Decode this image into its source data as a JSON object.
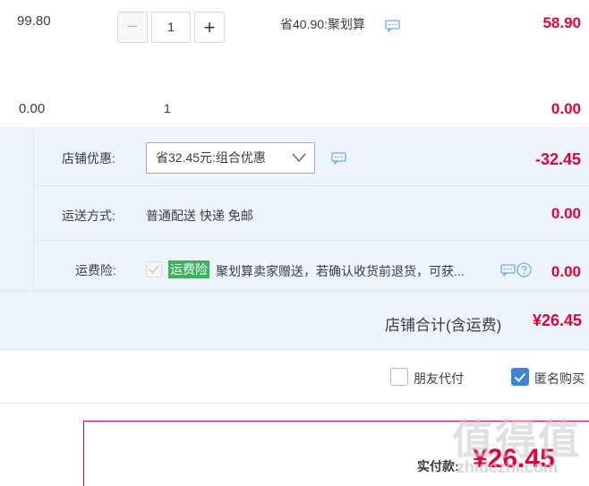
{
  "item1": {
    "unit_price": "99.80",
    "quantity": "1",
    "discount_note": "省40.90:聚划算",
    "subtotal": "58.90",
    "minus_symbol": "−",
    "plus_symbol": "+"
  },
  "item2": {
    "unit_price": "0.00",
    "quantity": "1",
    "subtotal": "0.00"
  },
  "shop": {
    "promo_label": "店铺优惠:",
    "promo_selected": "省32.45元:组合优惠",
    "promo_amount": "-32.45",
    "shipping_label": "运送方式:",
    "shipping_value": "普通配送 快递 免邮",
    "shipping_amount": "0.00",
    "insurance_label": "运费险:",
    "insurance_badge": "运费险",
    "insurance_text": "聚划算卖家赠送，若确认收货前退货，可获...",
    "insurance_amount": "0.00",
    "total_label": "店铺合计(含运费)",
    "total_value": "¥26.45"
  },
  "options": {
    "friend_pay_label": "朋友代付",
    "anonymous_label": "匿名购买",
    "anonymous_checked": true
  },
  "payment": {
    "label": "实付款:",
    "amount": "¥26.45"
  },
  "watermark": {
    "text": "值得值",
    "sub": "zhidezhi.com"
  },
  "colors": {
    "price_red": "#e4003a",
    "shop_bg": "#eef4fb",
    "insurance_green": "#3bb25c",
    "checkbox_blue": "#3d84de"
  },
  "icons": [
    "chat-icon",
    "help-icon",
    "chevron-down-icon",
    "check-icon"
  ]
}
